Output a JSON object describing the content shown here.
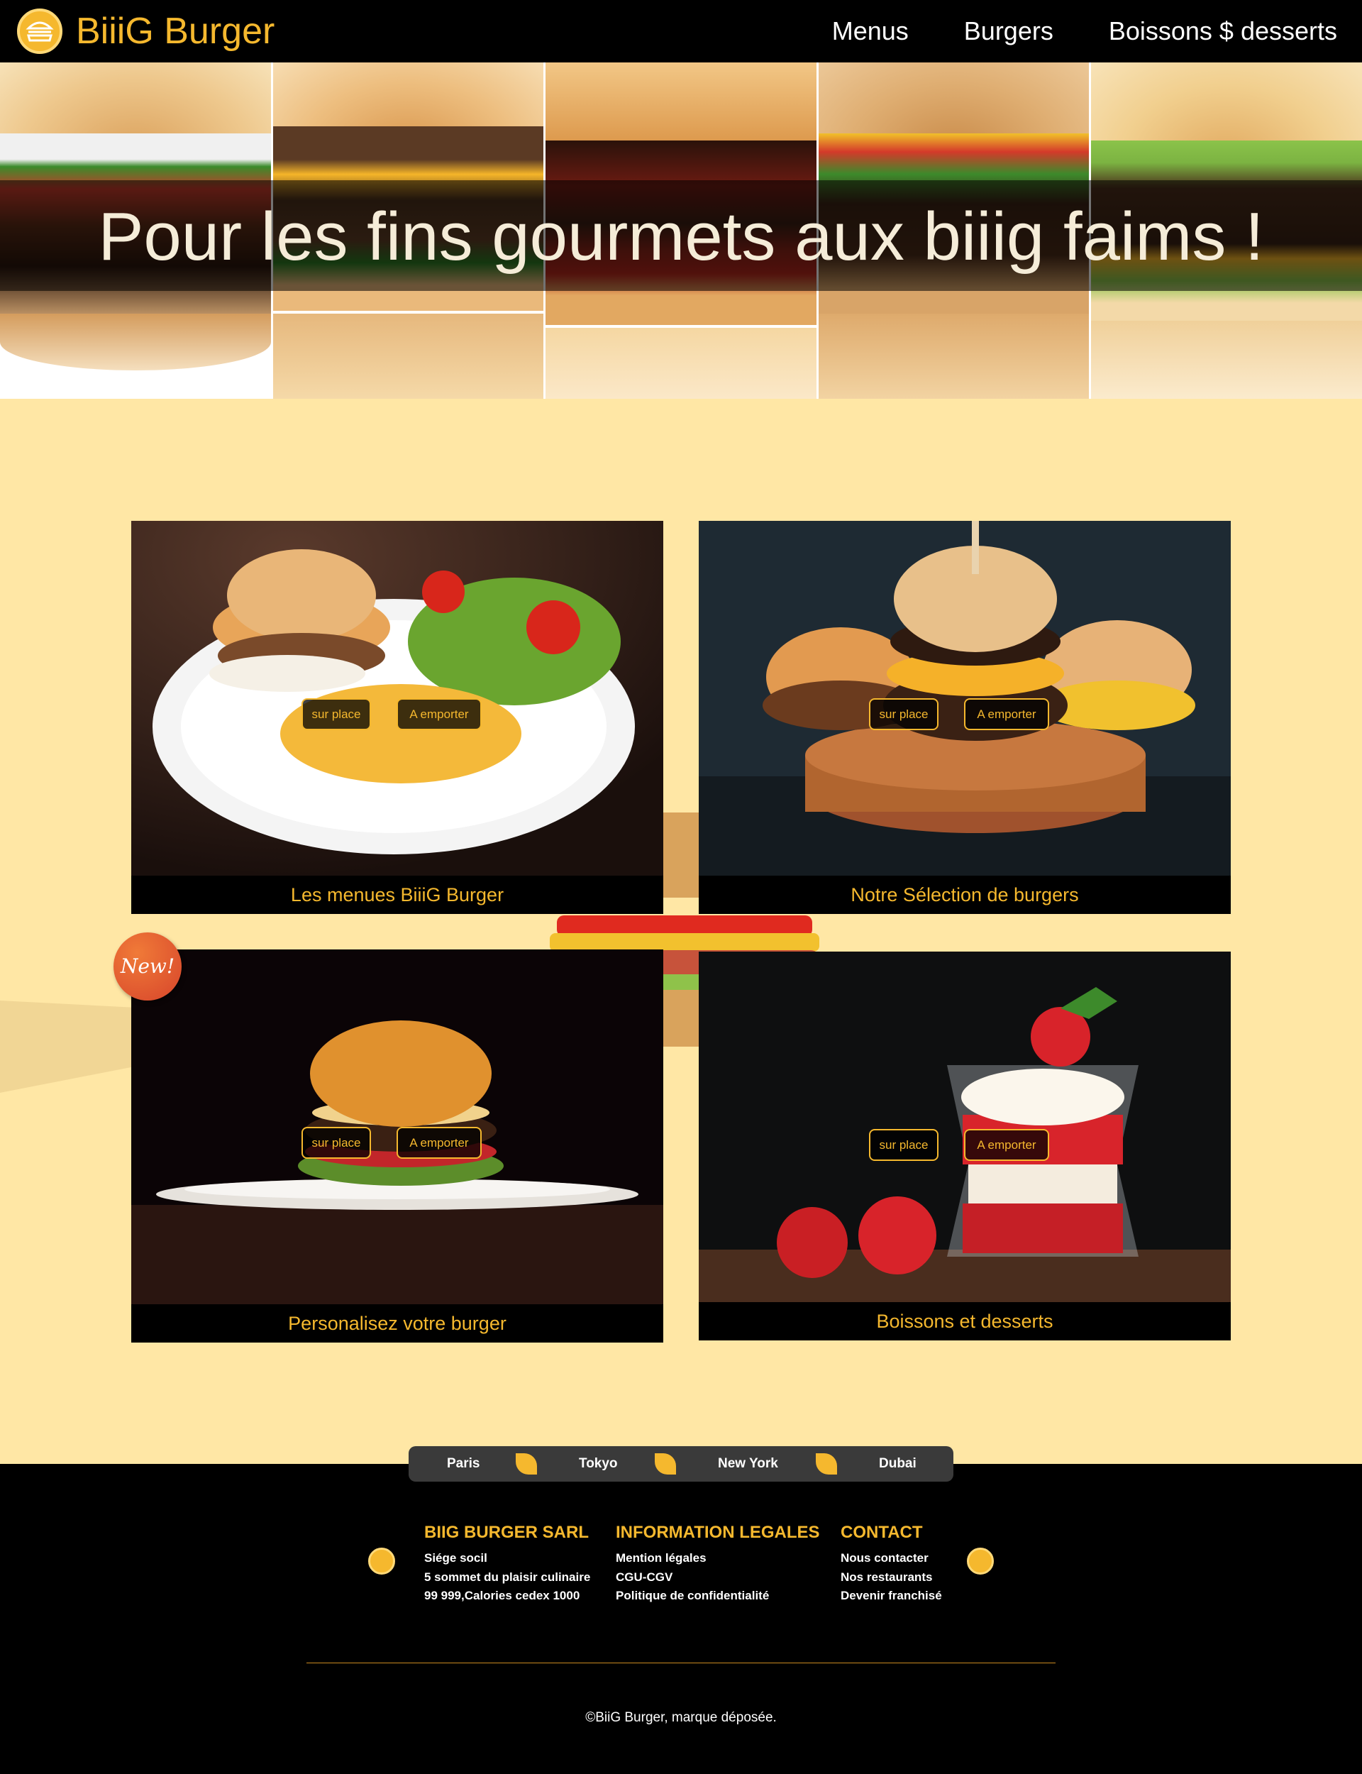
{
  "header": {
    "brand": "BiiiG Burger",
    "logo_icon": "burger-icon",
    "nav": [
      "Menus",
      "Burgers",
      "Boissons $ desserts"
    ]
  },
  "hero": {
    "title": "Pour les fins gourmets aux biiig faims !"
  },
  "cards": [
    {
      "caption": "Les menues BiiiG Burger",
      "btn_place": "sur place",
      "btn_emporter": "A emporter"
    },
    {
      "caption": "Notre Sélection de burgers",
      "btn_place": "sur place",
      "btn_emporter": "A emporter"
    },
    {
      "caption": "Personalisez votre burger",
      "btn_place": "sur place",
      "btn_emporter": "A emporter",
      "badge": "New!"
    },
    {
      "caption": "Boissons et desserts",
      "btn_place": "sur place",
      "btn_emporter": "A emporter"
    }
  ],
  "cities": [
    "Paris",
    "Tokyo",
    "New York",
    "Dubai"
  ],
  "footer": {
    "col1": {
      "title": "BIIG BURGER SARL",
      "lines": [
        "Siége socil",
        "5 sommet du plaisir culinaire",
        "99 999,Calories cedex 1000"
      ]
    },
    "col2": {
      "title": "INFORMATION LEGALES",
      "lines": [
        "Mention légales",
        "CGU-CGV",
        "Politique de confidentialité"
      ]
    },
    "col3": {
      "title": "CONTACT",
      "lines": [
        "Nous contacter",
        "Nos restaurants",
        "Devenir franchisé"
      ]
    },
    "copyright": "©BiiG Burger, marque déposée."
  },
  "colors": {
    "accent": "#f5b82e",
    "background": "#ffe7a5",
    "dark": "#000000"
  }
}
